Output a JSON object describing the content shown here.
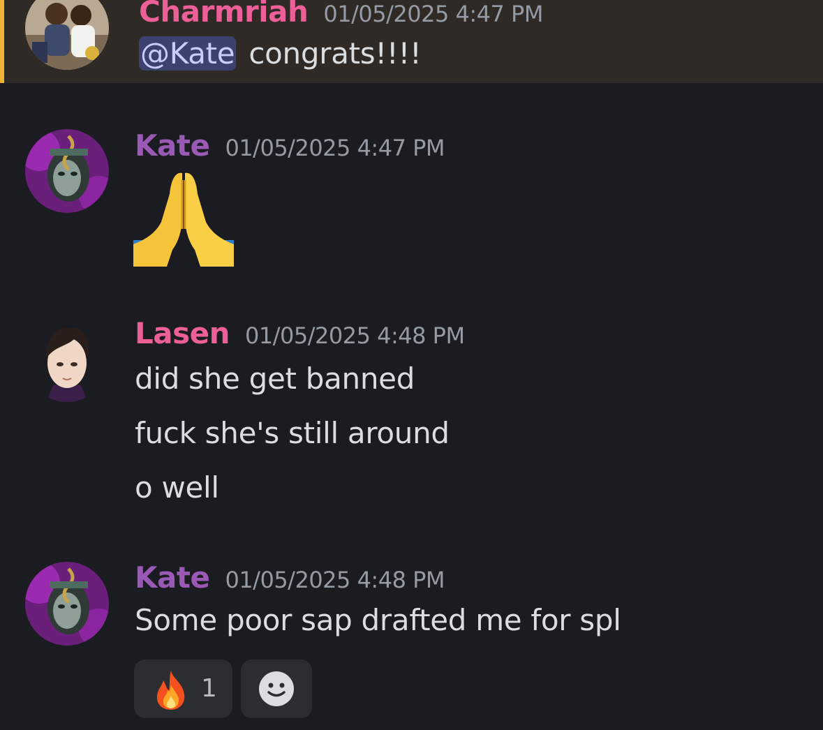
{
  "colors": {
    "background": "#1b1c21",
    "mention_highlight_bg": "#2f2a25",
    "mention_highlight_border": "#f0b232",
    "username_pink": "#ec5f98",
    "username_purple": "#9b59b6",
    "timestamp": "#949ba4",
    "text": "#dbdee1",
    "mention_pill_bg": "#3c4270",
    "mention_pill_text": "#c9cdfb"
  },
  "messages": [
    {
      "author": "Charmriah",
      "timestamp": "01/05/2025 4:47 PM",
      "mention": "@Kate",
      "text": "congrats!!!!",
      "avatar": "basketball-avatar"
    },
    {
      "author": "Kate",
      "timestamp": "01/05/2025 4:47 PM",
      "emoji": "folded-hands-emoji",
      "avatar": "masked-character-avatar"
    },
    {
      "author": "Lasen",
      "timestamp": "01/05/2025 4:48 PM",
      "lines": [
        "did she get banned",
        "fuck she's still around",
        "o well"
      ],
      "avatar": "drawn-boy-avatar"
    },
    {
      "author": "Kate",
      "timestamp": "01/05/2025 4:48 PM",
      "text": "Some poor sap drafted me for spl",
      "avatar": "masked-character-avatar",
      "reactions": [
        {
          "emoji": "fire-icon",
          "count": "1"
        },
        {
          "emoji": "add-reaction-icon"
        }
      ]
    }
  ]
}
